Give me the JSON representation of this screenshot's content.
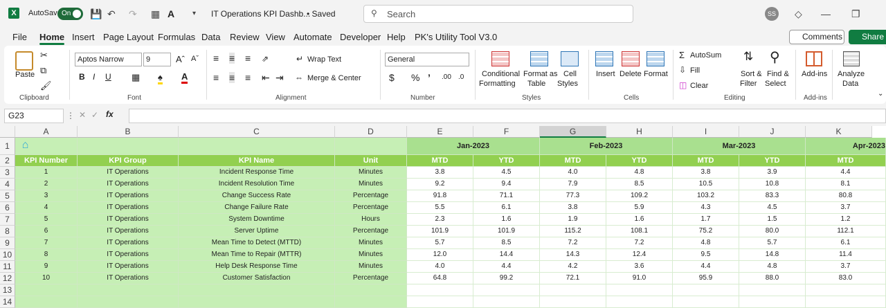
{
  "title": {
    "autosave": "AutoSave",
    "toggle": "On",
    "doc": "IT Operations KPI Dashb...",
    "saved": "• Saved",
    "search": "Search",
    "avatar": "SS"
  },
  "menu": [
    "File",
    "Home",
    "Insert",
    "Page Layout",
    "Formulas",
    "Data",
    "Review",
    "View",
    "Automate",
    "Developer",
    "Help",
    "PK's Utility Tool V3.0"
  ],
  "actions": {
    "comments": "Comments",
    "share": "Share"
  },
  "ribbon": {
    "clipboard": {
      "paste": "Paste",
      "label": "Clipboard"
    },
    "font": {
      "name": "Aptos Narrow",
      "size": "9",
      "label": "Font"
    },
    "alignment": {
      "wrap": "Wrap Text",
      "merge": "Merge & Center",
      "label": "Alignment"
    },
    "number": {
      "format": "General",
      "label": "Number"
    },
    "styles": {
      "cond": "Conditional",
      "cond2": "Formatting",
      "fmt": "Format as",
      "fmt2": "Table",
      "cell": "Cell",
      "cell2": "Styles",
      "label": "Styles"
    },
    "cells": {
      "insert": "Insert",
      "delete": "Delete",
      "format": "Format",
      "label": "Cells"
    },
    "editing": {
      "autosum": "AutoSum",
      "fill": "Fill",
      "clear": "Clear",
      "sort": "Sort &",
      "sort2": "Filter",
      "find": "Find &",
      "find2": "Select",
      "label": "Editing"
    },
    "addins": {
      "btn": "Add-ins",
      "label": "Add-ins"
    },
    "analyze": {
      "l1": "Analyze",
      "l2": "Data"
    }
  },
  "namebox": "G23",
  "columns": [
    "A",
    "B",
    "C",
    "D",
    "E",
    "F",
    "G",
    "H",
    "I",
    "J",
    "K"
  ],
  "rows": [
    "1",
    "2",
    "3",
    "4",
    "5",
    "6",
    "7",
    "8",
    "9",
    "10",
    "11",
    "12",
    "13",
    "14"
  ],
  "months": [
    "Jan-2023",
    "Feb-2023",
    "Mar-2023",
    "Apr-2023"
  ],
  "headers": [
    "KPI Number",
    "KPI Group",
    "KPI Name",
    "Unit",
    "MTD",
    "YTD",
    "MTD",
    "YTD",
    "MTD",
    "YTD",
    "MTD"
  ],
  "data": [
    [
      "1",
      "IT Operations",
      "Incident Response Time",
      "Minutes",
      "3.8",
      "4.5",
      "4.0",
      "4.8",
      "3.8",
      "3.9",
      "4.4"
    ],
    [
      "2",
      "IT Operations",
      "Incident Resolution Time",
      "Minutes",
      "9.2",
      "9.4",
      "7.9",
      "8.5",
      "10.5",
      "10.8",
      "8.1"
    ],
    [
      "3",
      "IT Operations",
      "Change Success Rate",
      "Percentage",
      "91.8",
      "71.1",
      "77.3",
      "109.2",
      "103.2",
      "83.3",
      "80.8"
    ],
    [
      "4",
      "IT Operations",
      "Change Failure Rate",
      "Percentage",
      "5.5",
      "6.1",
      "3.8",
      "5.9",
      "4.3",
      "4.5",
      "3.7"
    ],
    [
      "5",
      "IT Operations",
      "System Downtime",
      "Hours",
      "2.3",
      "1.6",
      "1.9",
      "1.6",
      "1.7",
      "1.5",
      "1.2"
    ],
    [
      "6",
      "IT Operations",
      "Server Uptime",
      "Percentage",
      "101.9",
      "101.9",
      "115.2",
      "108.1",
      "75.2",
      "80.0",
      "112.1"
    ],
    [
      "7",
      "IT Operations",
      "Mean Time to Detect (MTTD)",
      "Minutes",
      "5.7",
      "8.5",
      "7.2",
      "7.2",
      "4.8",
      "5.7",
      "6.1"
    ],
    [
      "8",
      "IT Operations",
      "Mean Time to Repair (MTTR)",
      "Minutes",
      "12.0",
      "14.4",
      "14.3",
      "12.4",
      "9.5",
      "14.8",
      "11.4"
    ],
    [
      "9",
      "IT Operations",
      "Help Desk Response Time",
      "Minutes",
      "4.0",
      "4.4",
      "4.2",
      "3.6",
      "4.4",
      "4.8",
      "3.7"
    ],
    [
      "10",
      "IT Operations",
      "Customer Satisfaction",
      "Percentage",
      "64.8",
      "99.2",
      "72.1",
      "91.0",
      "95.9",
      "88.0",
      "83.0"
    ]
  ]
}
